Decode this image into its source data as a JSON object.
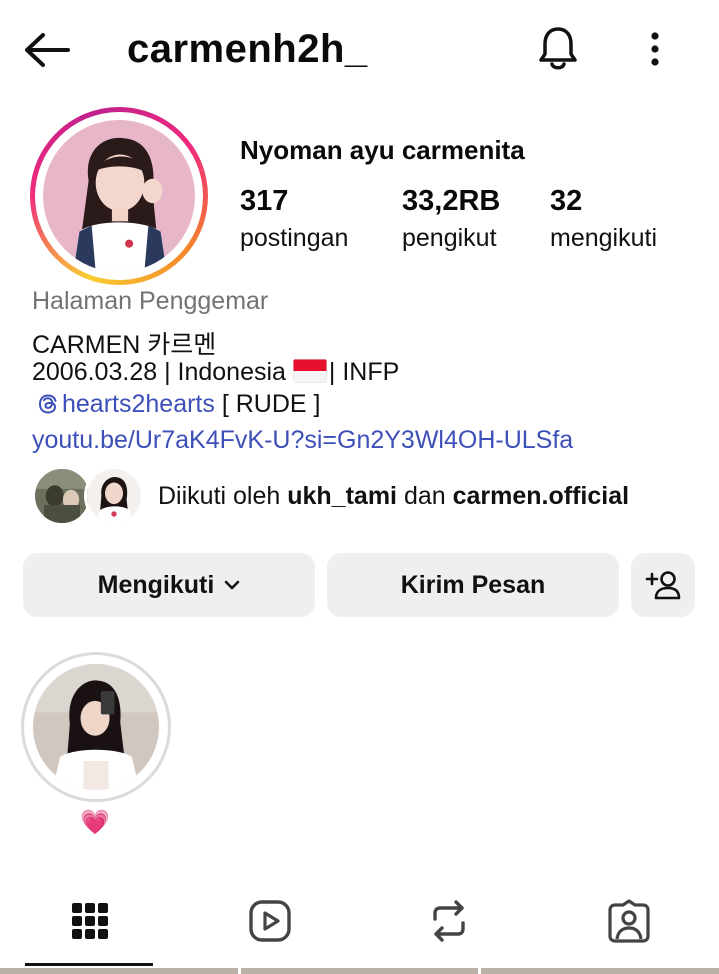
{
  "header": {
    "username": "carmenh2h_",
    "icons": {
      "back": "arrow-left-icon",
      "notifications": "bell-icon",
      "more": "more-vertical-icon"
    }
  },
  "profile": {
    "full_name": "Nyoman ayu carmenita",
    "stats": [
      {
        "value": "317",
        "label": "postingan"
      },
      {
        "value": "33,2RB",
        "label": "pengikut"
      },
      {
        "value": "32",
        "label": "mengikuti"
      }
    ],
    "category": "Halaman Penggemar",
    "bio_name": "CARMEN 카르멘",
    "bio_line2_before_flag": "2006.03.28 | Indonesia ",
    "bio_line2_after_flag": "| INFP",
    "bio_mention": "hearts2hearts",
    "bio_mention_suffix": " [ RUDE ]",
    "link": "youtu.be/Ur7aK4FvK-U?si=Gn2Y3Wl4OH-ULSfa"
  },
  "followed_by": {
    "prefix": "Diikuti oleh ",
    "user1": "ukh_tami",
    "conjunction": " dan ",
    "user2": "carmen.official"
  },
  "actions": {
    "follow_label": "Mengikuti",
    "message_label": "Kirim Pesan"
  },
  "highlights": [
    {
      "label": "💗"
    }
  ],
  "tabs": [
    {
      "name": "posts",
      "icon": "grid-icon",
      "active": true
    },
    {
      "name": "reels",
      "icon": "reels-icon",
      "active": false
    },
    {
      "name": "reposts",
      "icon": "repost-icon",
      "active": false
    },
    {
      "name": "tagged",
      "icon": "tagged-icon",
      "active": false
    }
  ],
  "colors": {
    "link": "#3d4fb8",
    "button_bg": "#efeff2",
    "muted": "#737373",
    "story_ring_start": "#f9ce34",
    "story_ring_mid": "#ee2a7b"
  }
}
